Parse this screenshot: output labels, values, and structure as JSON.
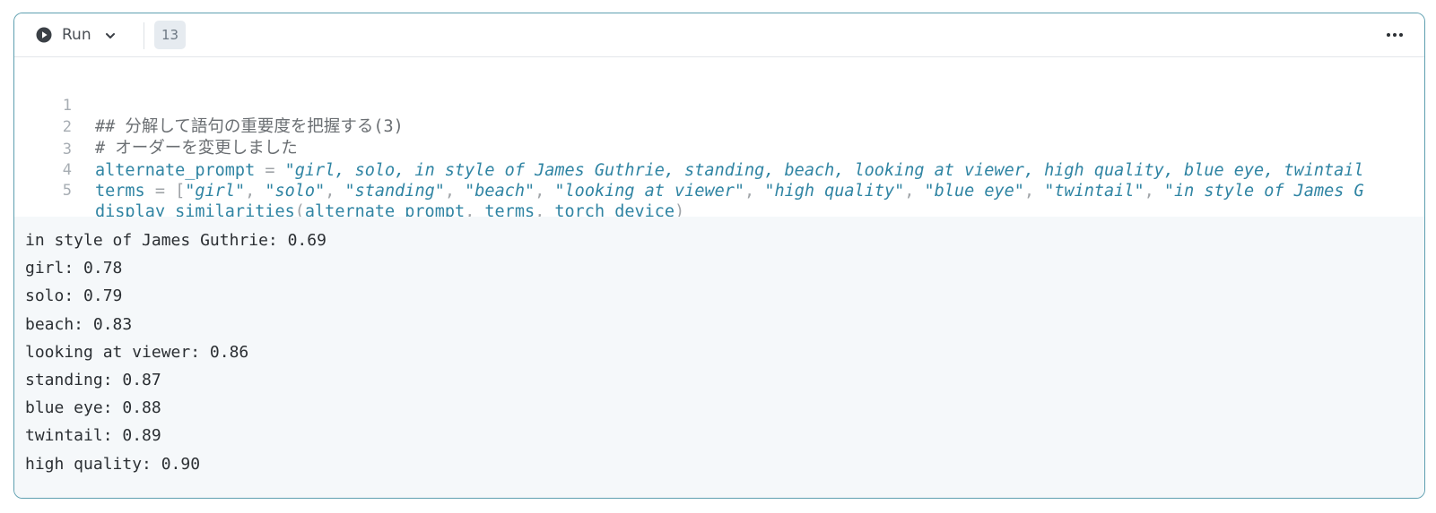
{
  "toolbar": {
    "run_label": "Run",
    "run_icon": "play-circle-icon",
    "dropdown_icon": "chevron-down-icon",
    "execution_count": "13",
    "more_icon": "more-horizontal-icon"
  },
  "code": {
    "line_numbers": [
      "1",
      "2",
      "3",
      "4",
      "5"
    ],
    "line1": "## 分解して語句の重要度を把握する(3)",
    "line2": "# オーダーを変更しました",
    "line3": {
      "var": "alternate_prompt",
      "op": " = ",
      "str": "\"girl, solo, in style of James Guthrie, standing, beach, looking at viewer, high quality, blue eye, twintail"
    },
    "line4": {
      "var": "terms",
      "op": " = [",
      "items": [
        "\"girl\"",
        "\"solo\"",
        "\"standing\"",
        "\"beach\"",
        "\"looking at viewer\"",
        "\"high quality\"",
        "\"blue eye\"",
        "\"twintail\"",
        "\"in style of James G"
      ],
      "sep": ", "
    },
    "line5": {
      "func": "display_similarities",
      "open": "(",
      "args": [
        "alternate_prompt",
        "terms",
        "torch_device"
      ],
      "sep": ", ",
      "close": ")"
    }
  },
  "output": {
    "lines": [
      "in style of James Guthrie: 0.69",
      "girl: 0.78",
      "solo: 0.79",
      "beach: 0.83",
      "looking at viewer: 0.86",
      "standing: 0.87",
      "blue eye: 0.88",
      "twintail: 0.89",
      "high quality: 0.90"
    ]
  },
  "colors": {
    "cell_border": "#5e9fb0",
    "code_identifier": "#2f84a3",
    "comment": "#6b6f73",
    "output_bg": "#f5f8fa"
  }
}
